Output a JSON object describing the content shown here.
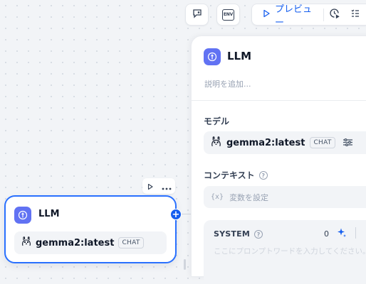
{
  "toolbar": {
    "preview_label": "プレビュー",
    "env_label": "ENV"
  },
  "node": {
    "title": "LLM",
    "model": "gemma2:latest",
    "mode_badge": "CHAT"
  },
  "panel": {
    "title": "LLM",
    "description_placeholder": "説明を追加...",
    "model_label": "モデル",
    "model_name": "gemma2:latest",
    "model_mode": "CHAT",
    "context_label": "コンテキスト",
    "context_icon_text": "{x}",
    "context_placeholder": "変数を設定",
    "system": {
      "label": "SYSTEM",
      "char_count": "0",
      "placeholder": "ここにプロンプトワードを入力してください。変"
    }
  },
  "colors": {
    "accent": "#155eef",
    "node_border": "#2970ff",
    "llm_icon_bg": "#6172f3"
  }
}
